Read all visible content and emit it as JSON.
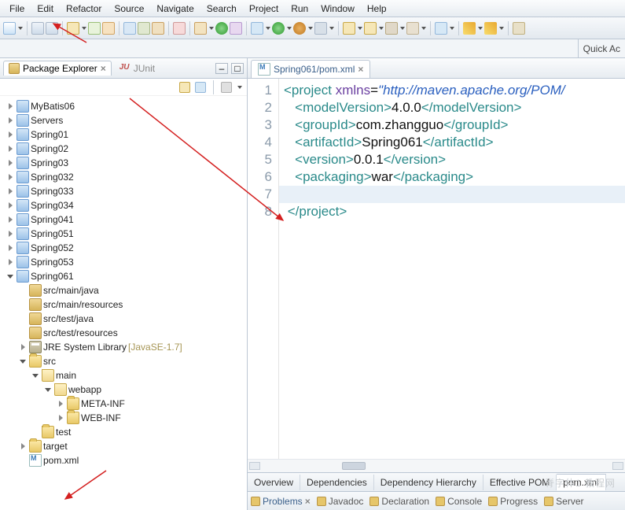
{
  "menu": [
    "File",
    "Edit",
    "Refactor",
    "Source",
    "Navigate",
    "Search",
    "Project",
    "Run",
    "Window",
    "Help"
  ],
  "quick_access": "Quick Ac",
  "package_explorer": {
    "title": "Package Explorer",
    "other_tab": "JUnit"
  },
  "tree": {
    "projects": [
      {
        "name": "MyBatis06",
        "expanded": false
      },
      {
        "name": "Servers",
        "expanded": false
      },
      {
        "name": "Spring01",
        "expanded": false
      },
      {
        "name": "Spring02",
        "expanded": false
      },
      {
        "name": "Spring03",
        "expanded": false
      },
      {
        "name": "Spring032",
        "expanded": false
      },
      {
        "name": "Spring033",
        "expanded": false
      },
      {
        "name": "Spring034",
        "expanded": false
      },
      {
        "name": "Spring041",
        "expanded": false
      },
      {
        "name": "Spring051",
        "expanded": false
      },
      {
        "name": "Spring052",
        "expanded": false
      },
      {
        "name": "Spring053",
        "expanded": false
      },
      {
        "name": "Spring061",
        "expanded": true
      }
    ],
    "spring061": {
      "src_folders": [
        "src/main/java",
        "src/main/resources",
        "src/test/java",
        "src/test/resources"
      ],
      "jre": {
        "label": "JRE System Library",
        "deco": "[JavaSE-1.7]"
      },
      "src_tree": {
        "label": "src",
        "main": {
          "label": "main",
          "webapp": {
            "label": "webapp",
            "children": [
              "META-INF",
              "WEB-INF"
            ]
          }
        },
        "test": "test"
      },
      "target": "target",
      "pom": "pom.xml"
    }
  },
  "editor": {
    "tab_title": "Spring061/pom.xml",
    "lines": [
      {
        "n": 1,
        "parts": [
          {
            "c": "t-tag",
            "t": "<project "
          },
          {
            "c": "t-attr",
            "t": "xmlns"
          },
          {
            "c": "t-txt",
            "t": "="
          },
          {
            "c": "t-str",
            "t": "\"http://maven.apache.org/POM/"
          }
        ]
      },
      {
        "n": 2,
        "parts": [
          {
            "c": "",
            "t": "   "
          },
          {
            "c": "t-tag",
            "t": "<modelVersion>"
          },
          {
            "c": "t-txt",
            "t": "4.0.0"
          },
          {
            "c": "t-tag",
            "t": "</modelVersion>"
          }
        ]
      },
      {
        "n": 3,
        "parts": [
          {
            "c": "",
            "t": "   "
          },
          {
            "c": "t-tag",
            "t": "<groupId>"
          },
          {
            "c": "t-txt",
            "t": "com.zhangguo"
          },
          {
            "c": "t-tag",
            "t": "</groupId>"
          }
        ]
      },
      {
        "n": 4,
        "parts": [
          {
            "c": "",
            "t": "   "
          },
          {
            "c": "t-tag",
            "t": "<artifactId>"
          },
          {
            "c": "t-txt",
            "t": "Spring061"
          },
          {
            "c": "t-tag",
            "t": "</artifactId>"
          }
        ]
      },
      {
        "n": 5,
        "parts": [
          {
            "c": "",
            "t": "   "
          },
          {
            "c": "t-tag",
            "t": "<version>"
          },
          {
            "c": "t-txt",
            "t": "0.0.1"
          },
          {
            "c": "t-tag",
            "t": "</version>"
          }
        ]
      },
      {
        "n": 6,
        "parts": [
          {
            "c": "",
            "t": "   "
          },
          {
            "c": "t-tag",
            "t": "<packaging>"
          },
          {
            "c": "t-txt",
            "t": "war"
          },
          {
            "c": "t-tag",
            "t": "</packaging>"
          }
        ]
      },
      {
        "n": 7,
        "parts": []
      },
      {
        "n": 8,
        "parts": [
          {
            "c": "",
            "t": " "
          },
          {
            "c": "t-tag",
            "t": "</project>"
          }
        ]
      }
    ],
    "bottom_tabs": [
      "Overview",
      "Dependencies",
      "Dependency Hierarchy",
      "Effective POM",
      "pom.xml"
    ],
    "active_bottom_tab": 4
  },
  "bottom_views": [
    "Problems",
    "Javadoc",
    "Declaration",
    "Console",
    "Progress",
    "Server"
  ],
  "watermark": "脊字体1 教程网"
}
